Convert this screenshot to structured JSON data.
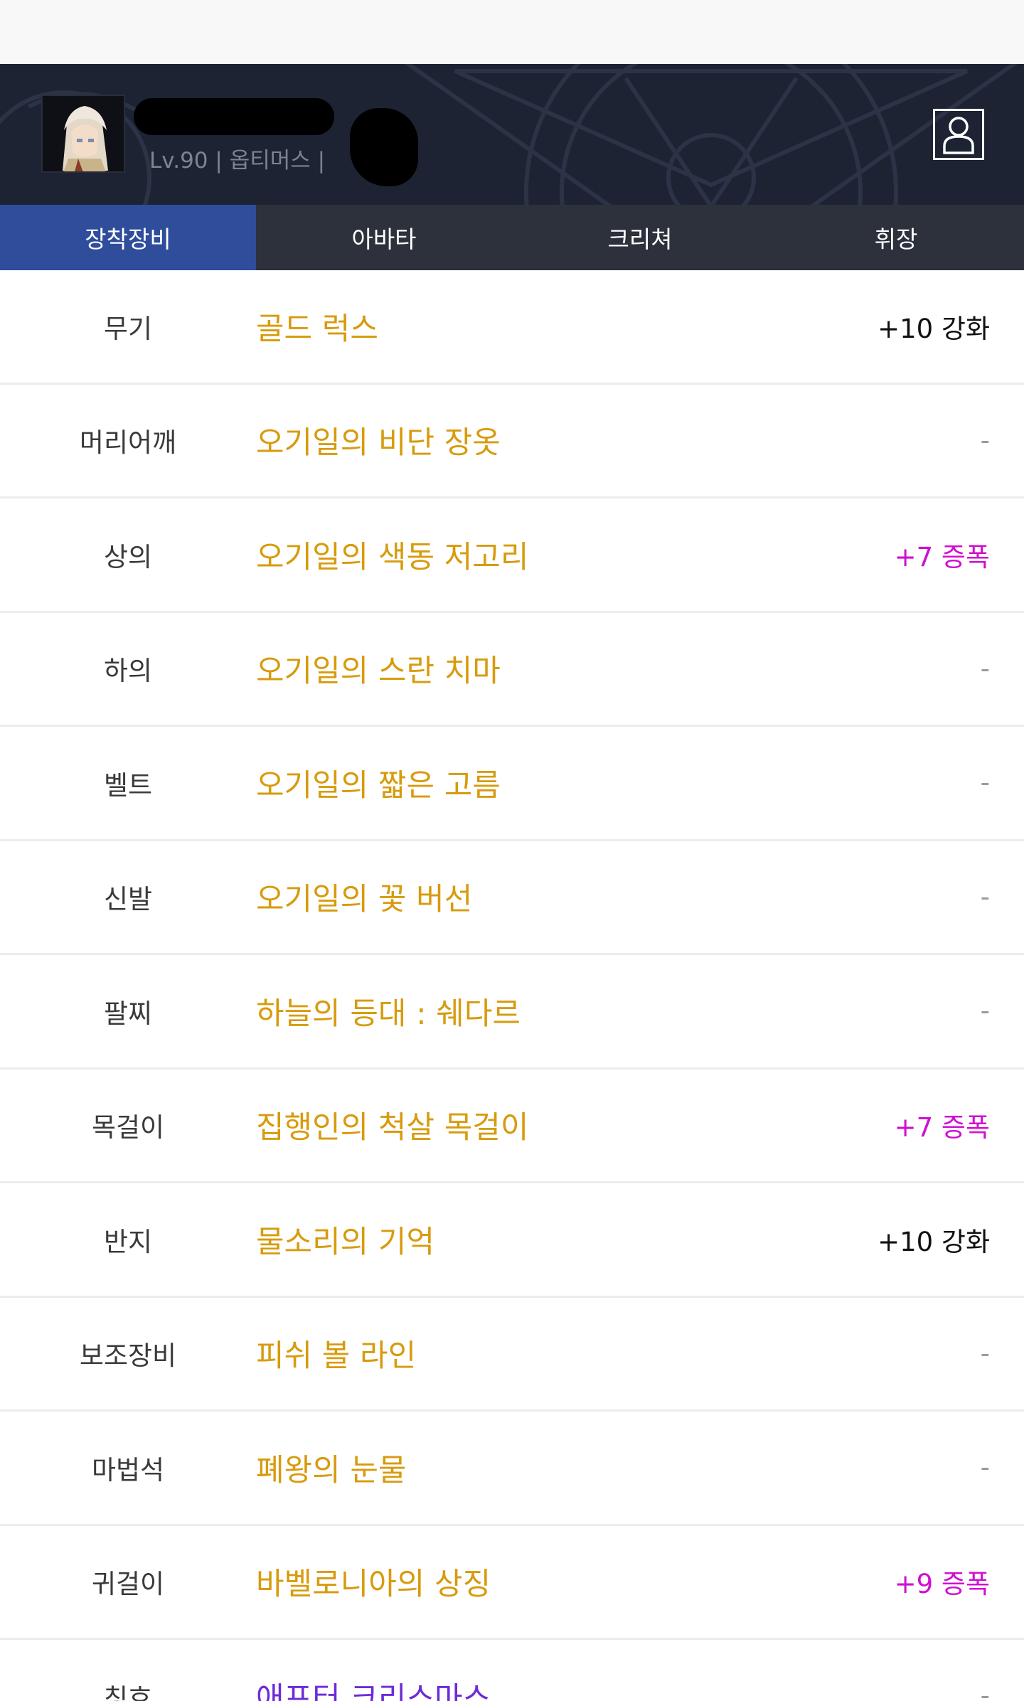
{
  "profile": {
    "level": "Lv.90",
    "separator": "|",
    "job": "옵티머스",
    "server_fragment": "",
    "button_icon": "person-icon"
  },
  "tabs": [
    {
      "label": "장착장비",
      "active": true
    },
    {
      "label": "아바타",
      "active": false
    },
    {
      "label": "크리쳐",
      "active": false
    },
    {
      "label": "휘장",
      "active": false
    }
  ],
  "equipment": [
    {
      "slot": "무기",
      "item": "골드 럭스",
      "upgrade": "+10 강화",
      "upgrade_type": "reinforce"
    },
    {
      "slot": "머리어깨",
      "item": "오기일의 비단 장옷",
      "upgrade": "-",
      "upgrade_type": "none"
    },
    {
      "slot": "상의",
      "item": "오기일의 색동 저고리",
      "upgrade": "+7 증폭",
      "upgrade_type": "amplify"
    },
    {
      "slot": "하의",
      "item": "오기일의 스란 치마",
      "upgrade": "-",
      "upgrade_type": "none"
    },
    {
      "slot": "벨트",
      "item": "오기일의 짧은 고름",
      "upgrade": "-",
      "upgrade_type": "none"
    },
    {
      "slot": "신발",
      "item": "오기일의 꽃 버선",
      "upgrade": "-",
      "upgrade_type": "none"
    },
    {
      "slot": "팔찌",
      "item": "하늘의 등대 : 쉐다르",
      "upgrade": "-",
      "upgrade_type": "none"
    },
    {
      "slot": "목걸이",
      "item": "집행인의 척살 목걸이",
      "upgrade": "+7 증폭",
      "upgrade_type": "amplify"
    },
    {
      "slot": "반지",
      "item": "물소리의 기억",
      "upgrade": "+10 강화",
      "upgrade_type": "reinforce"
    },
    {
      "slot": "보조장비",
      "item": "피쉬 볼 라인",
      "upgrade": "-",
      "upgrade_type": "none"
    },
    {
      "slot": "마법석",
      "item": "폐왕의 눈물",
      "upgrade": "-",
      "upgrade_type": "none"
    },
    {
      "slot": "귀걸이",
      "item": "바벨로니아의 상징",
      "upgrade": "+9 증폭",
      "upgrade_type": "amplify"
    },
    {
      "slot": "칭호",
      "item": "애프터 크리스마스",
      "upgrade": "-",
      "upgrade_type": "none"
    }
  ],
  "colors": {
    "item_gold": "#d79b0d",
    "item_purple": "#6d2bd9",
    "amplify_magenta": "#d10fd2",
    "tab_active": "#2f4d9b",
    "tab_bar": "#2d313c",
    "profile_bg": "#1d2333"
  }
}
